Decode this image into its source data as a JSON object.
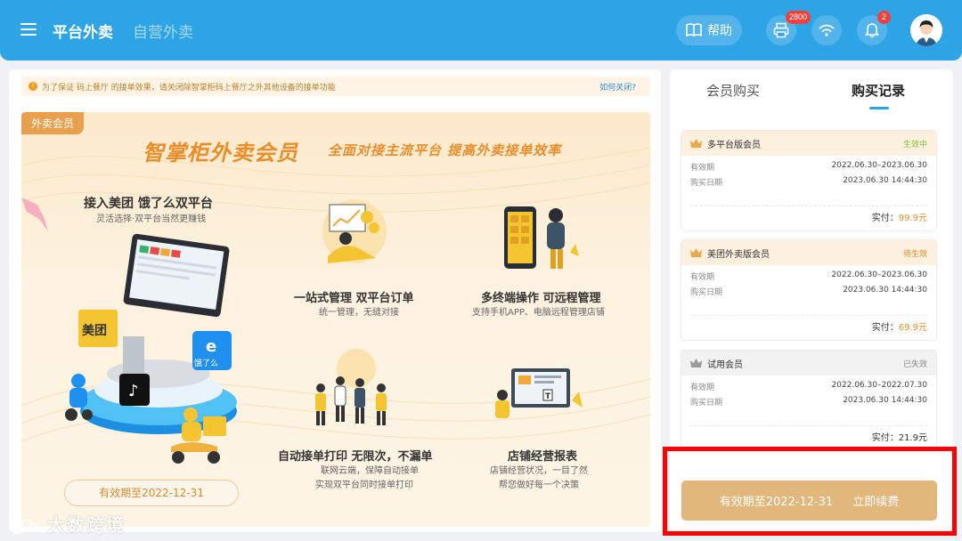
{
  "header": {
    "tabs": [
      {
        "label": "平台外卖",
        "active": true
      },
      {
        "label": "自营外卖",
        "active": false
      }
    ],
    "help_label": "帮助",
    "printer_badge": "2800",
    "notification_badge": "2"
  },
  "notice": {
    "text": "为了保证 码上餐厅 的接单效果，请关闭除智掌柜码上餐厅之外其他设备的接单功能",
    "link": "如何关闭?"
  },
  "promo": {
    "tag": "外卖会员",
    "title": "智掌柜外卖会员",
    "subtitle": "全面对接主流平台  提高外卖接单效率",
    "headline": "接入美团  饿了么双平台",
    "headline_desc": "灵活选择·双平台当然更赚钱",
    "platforms": {
      "meituan": "美团",
      "eleme": "饿了么"
    },
    "features": [
      {
        "title": "一站式管理  双平台订单",
        "desc": [
          "统一管理，无缝对接"
        ]
      },
      {
        "title": "多终端操作  可远程管理",
        "desc": [
          "支持手机APP、电脑远程管理店铺"
        ]
      },
      {
        "title": "自动接单打印  无限次，不漏单",
        "desc": [
          "联网云端，保障自动接单",
          "实现双平台同时接单打印"
        ]
      },
      {
        "title": "店铺经营报表",
        "desc": [
          "店铺经营状况，一目了然",
          "帮您做好每一个决策"
        ]
      }
    ],
    "valid_until": "有效期至2022-12-31"
  },
  "records": {
    "tabs": [
      "会员购买",
      "购买记录"
    ],
    "active_tab": 1,
    "labels": {
      "valid": "有效期",
      "purchase": "购买日期",
      "paid": "实付："
    },
    "items": [
      {
        "name": "多平台版会员",
        "status": "生效中",
        "status_color": "#7cbf3a",
        "valid": "2022.06.30–2023.06.30",
        "date": "2023.06.30 14:44:30",
        "amount": "99.9元",
        "grey": false
      },
      {
        "name": "美团外卖版会员",
        "status": "待生效",
        "status_color": "#e98e2a",
        "valid": "2022.06.30–2023.06.30",
        "date": "2023.06.30 14:44:30",
        "amount": "69.9元",
        "grey": false
      },
      {
        "name": "试用会员",
        "status": "已失效",
        "status_color": "#888888",
        "valid": "2022.06.30–2022.07.30",
        "date": "2023.06.30 14:44:30",
        "amount": "21.9元",
        "grey": true
      }
    ],
    "renew": {
      "valid_until": "有效期至2022-12-31",
      "action": "立即续费"
    }
  },
  "watermark": "大数跨境",
  "colors": {
    "brand": "#2da4e6",
    "gold": "#e1b77c",
    "accent": "#e98e2a",
    "highlight": "#ff0000"
  }
}
